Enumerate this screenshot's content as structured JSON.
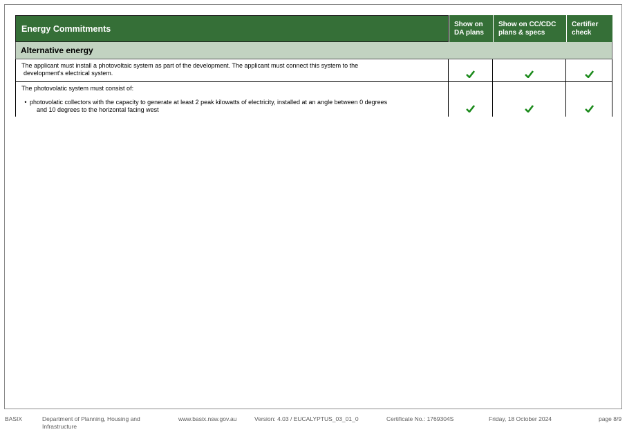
{
  "table": {
    "title": "Energy Commitments",
    "columns": [
      {
        "line1": "Show on",
        "line2": "DA plans"
      },
      {
        "line1": "Show on CC/CDC",
        "line2": "plans & specs"
      },
      {
        "line1": "Certifier",
        "line2": "check"
      }
    ],
    "section": "Alternative energy",
    "rows": [
      {
        "line1": "The applicant must install a photovoltaic system as part of the development. The applicant must connect this system to the",
        "line2": "development's electrical system.",
        "checks": [
          "check-icon",
          "check-icon",
          "check-icon"
        ]
      },
      {
        "intro": "The photovolatic system must consist of:",
        "bullet_line1": "photovolatic collectors with the capacity to generate at least 2 peak kilowatts of electricity, installed at an angle between 0 degrees",
        "bullet_line2": "and 10 degrees to the horizontal facing west",
        "checks": [
          "check-icon",
          "check-icon",
          "check-icon"
        ]
      }
    ]
  },
  "colors": {
    "header": "#356f37",
    "section": "#c2d3c1",
    "check": "#1b8a1b"
  },
  "footer": {
    "brand": "BASIX",
    "dept_line1": "Department of Planning, Housing and",
    "dept_line2": "Infrastructure",
    "site": "www.basix.nsw.gov.au",
    "version": "Version: 4.03 / EUCALYPTUS_03_01_0",
    "certificate": "Certificate No.: 1769304S",
    "date": "Friday, 18 October 2024",
    "page": "page 8/9"
  }
}
